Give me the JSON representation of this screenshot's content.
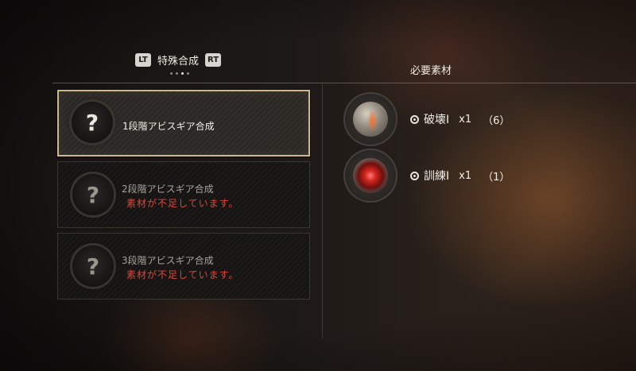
{
  "tabs": {
    "left_trigger": "LT",
    "title": "特殊合成",
    "right_trigger": "RT",
    "page_count": 4,
    "active_page": 3
  },
  "recipes": [
    {
      "title": "1段階アビスギア合成",
      "warning": "",
      "icon": "question-mark-icon",
      "selected": true
    },
    {
      "title": "2段階アビスギア合成",
      "warning": "素材が不足しています。",
      "icon": "question-mark-icon",
      "selected": false
    },
    {
      "title": "3段階アビスギア合成",
      "warning": "素材が不足しています。",
      "icon": "question-mark-icon",
      "selected": false
    }
  ],
  "materials_panel": {
    "title": "必要素材",
    "items": [
      {
        "name": "破壊I",
        "quantity": "x1",
        "owned": "（6）",
        "icon": "destruction-stone-icon"
      },
      {
        "name": "訓練I",
        "quantity": "x1",
        "owned": "（1）",
        "icon": "training-stone-icon"
      }
    ]
  },
  "colors": {
    "selected_border": "#cdb98a",
    "warning": "#d8463c"
  }
}
